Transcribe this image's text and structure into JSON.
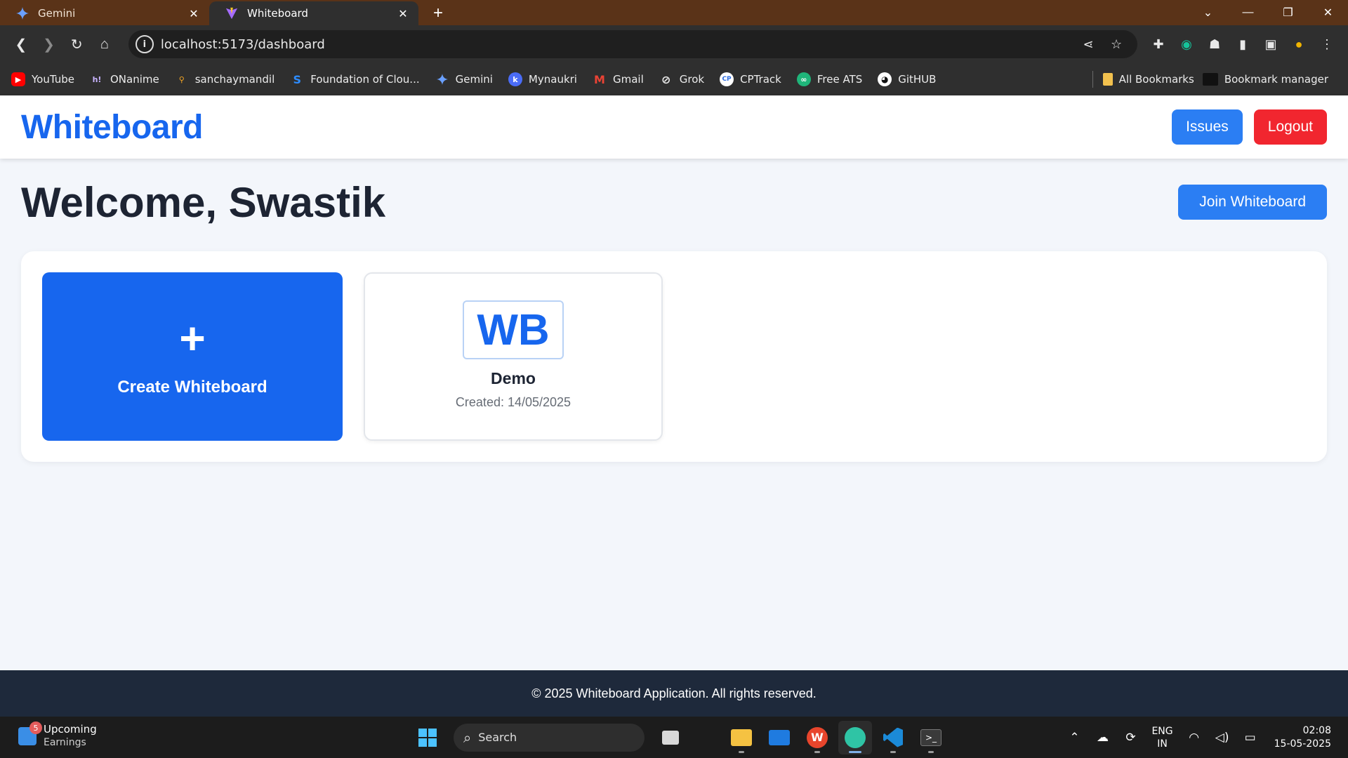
{
  "browser": {
    "tabs": [
      {
        "title": "Gemini",
        "icon": "gemini-sparkle-icon",
        "active": false
      },
      {
        "title": "Whiteboard",
        "icon": "vite-icon",
        "active": true
      }
    ],
    "url": "localhost:5173/dashboard",
    "bookmarks": [
      {
        "label": "YouTube",
        "icon": "youtube-icon"
      },
      {
        "label": "ONanime",
        "icon": "hi-icon"
      },
      {
        "label": "sanchaymandil",
        "icon": "sanchay-icon"
      },
      {
        "label": "Foundation of Clou...",
        "icon": "foundation-icon"
      },
      {
        "label": "Gemini",
        "icon": "gemini-sparkle-icon"
      },
      {
        "label": "Mynaukri",
        "icon": "naukri-icon"
      },
      {
        "label": "Gmail",
        "icon": "gmail-icon"
      },
      {
        "label": "Grok",
        "icon": "grok-icon"
      },
      {
        "label": "CPTrack",
        "icon": "cptrack-icon"
      },
      {
        "label": "Free ATS",
        "icon": "ats-icon"
      },
      {
        "label": "GitHUB",
        "icon": "github-icon"
      }
    ],
    "bookmarks_right": [
      {
        "label": "All Bookmarks",
        "icon": "folder-icon"
      },
      {
        "label": "Bookmark manager",
        "icon": "folder-dark-icon"
      }
    ]
  },
  "app": {
    "logo": "Whiteboard",
    "issues_label": "Issues",
    "logout_label": "Logout",
    "welcome": "Welcome, Swastik",
    "join_label": "Join Whiteboard",
    "create_label": "Create Whiteboard",
    "create_icon": "+",
    "boards": [
      {
        "thumb": "WB",
        "name": "Demo",
        "created": "Created: 14/05/2025"
      }
    ],
    "footer": "© 2025 Whiteboard Application. All rights reserved."
  },
  "colors": {
    "brand_blue": "#1766ee",
    "button_blue": "#2b7ef3",
    "logout_red": "#f1262f",
    "footer_bg": "#1e293b"
  },
  "taskbar": {
    "widget_title": "Upcoming",
    "widget_sub": "Earnings",
    "widget_badge": "5",
    "search_label": "Search",
    "lang_top": "ENG",
    "lang_bottom": "IN",
    "time": "02:08",
    "date": "15-05-2025"
  }
}
